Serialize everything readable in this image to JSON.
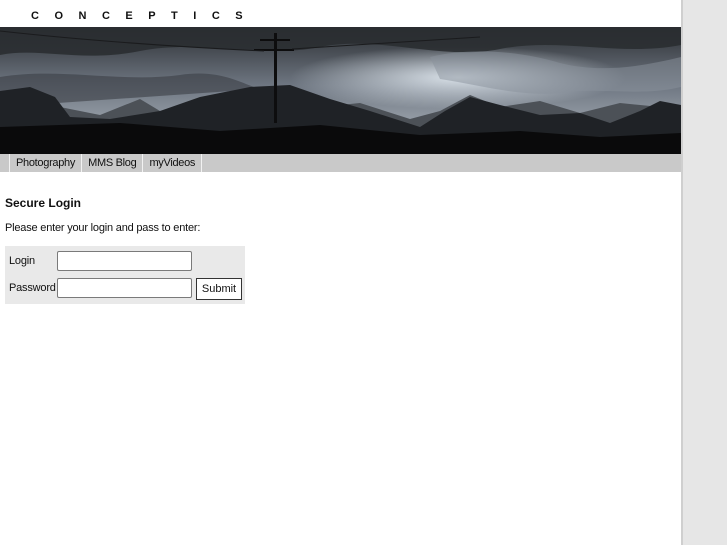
{
  "site": {
    "logo_text": "CONCEPTICS"
  },
  "banner": {
    "description_icon": "landscape-banner"
  },
  "nav": {
    "items": [
      {
        "label": "Photography"
      },
      {
        "label": "MMS Blog"
      },
      {
        "label": "myVideos"
      }
    ]
  },
  "main": {
    "heading": "Secure Login",
    "intro": "Please enter your login and pass to enter:"
  },
  "form": {
    "login_label": "Login",
    "login_value": "",
    "password_label": "Password",
    "password_value": "",
    "submit_label": "Submit"
  }
}
